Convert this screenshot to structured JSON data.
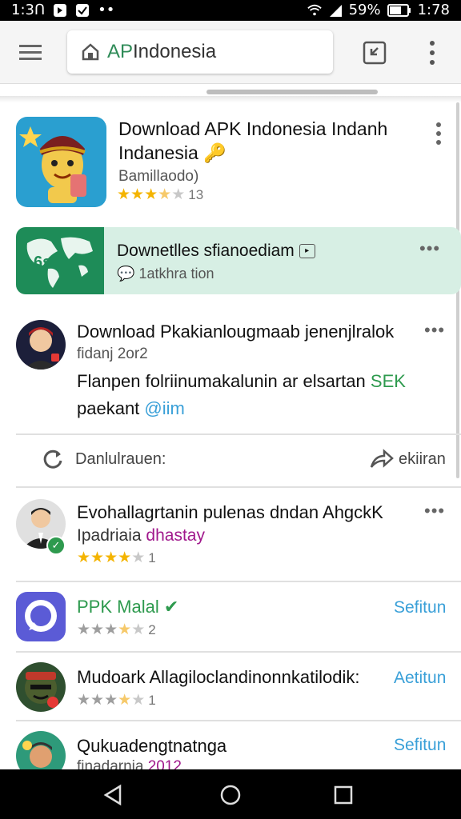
{
  "status": {
    "time_left": "1:3Ո",
    "battery": "59%",
    "time_right": "1:78"
  },
  "toolbar": {
    "url_prefix": "AP",
    "url_rest": "Indonesia"
  },
  "items": [
    {
      "title_line1": "Download APK Indonesia Indanh",
      "title_line2": "Indanesia",
      "subtitle": "Bamillaodo)",
      "rating_count": "13"
    },
    {
      "title": "Downetlles sfianoediam",
      "subtitle": "1atkhra tion",
      "icon_text": "6s"
    },
    {
      "title": "Download Pkakianlougmaab jenenjlralok",
      "date": "fidanj 2or2",
      "body_line1": "Flanpen folriinumakalunin ar elsartan",
      "body_line1_accent": "SEK",
      "body_line2": "paekant",
      "body_line2_accent": "@iim"
    },
    {
      "refresh_label": "Danlulrauen:",
      "share_label": "ekiiran"
    },
    {
      "title": "Evohallagrtanin pulenas dndan AhgckK",
      "subtitle": "Ipadriaia",
      "subtitle_accent": "dhastay",
      "rating_count": "1"
    },
    {
      "title": "PPK Malal",
      "rating_count": "2",
      "action": "Sefitun"
    },
    {
      "title": "Mudoark Allagiloclandinonnkatilodik:",
      "rating_count": "1",
      "action": "Aetitun"
    },
    {
      "title": "Qukuadengtnatnga",
      "subtitle": "finadarnia",
      "subtitle_accent": "2012",
      "action": "Sefitun"
    }
  ],
  "colors": {
    "accent_green": "#2e9a4e",
    "link_blue": "#3aa0d8",
    "star": "#f4b400",
    "purple": "#a0188c",
    "card_green": "#1e8c58"
  }
}
